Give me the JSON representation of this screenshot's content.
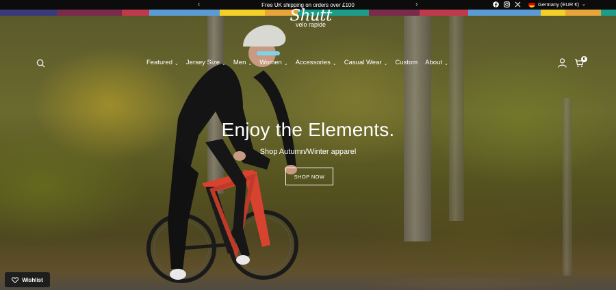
{
  "announcement": {
    "text": "Free UK shipping on orders over £100",
    "prev_icon": "chevron-left-icon",
    "next_icon": "chevron-right-icon"
  },
  "stripe_colors": [
    "#3a3a7a",
    "#7a2a4a",
    "#c0394b",
    "#5b9bd5",
    "#5b9bd5",
    "#f2d027",
    "#e8a63a",
    "#1a9e8a",
    "#7a2a4a",
    "#c0394b",
    "#5b9bd5",
    "#f2d027",
    "#e8a63a",
    "#1a9e8a"
  ],
  "social": {
    "items": [
      "facebook-icon",
      "instagram-icon",
      "x-icon"
    ]
  },
  "locale": {
    "label": "Germany (EUR €)",
    "flag_colors": [
      "#000000",
      "#dd0000",
      "#ffce00"
    ]
  },
  "logo": {
    "script": "Shutt",
    "sub": "velo rapide"
  },
  "nav": {
    "items": [
      {
        "label": "Featured",
        "has_dropdown": true
      },
      {
        "label": "Jersey Size",
        "has_dropdown": true
      },
      {
        "label": "Men",
        "has_dropdown": true
      },
      {
        "label": "Women",
        "has_dropdown": true
      },
      {
        "label": "Accessories",
        "has_dropdown": true
      },
      {
        "label": "Casual Wear",
        "has_dropdown": true
      },
      {
        "label": "Custom",
        "has_dropdown": false
      },
      {
        "label": "About",
        "has_dropdown": true
      }
    ]
  },
  "cart": {
    "count": "0"
  },
  "hero": {
    "headline": "Enjoy the Elements.",
    "subline": "Shop Autumn/Winter apparel",
    "button": "SHOP NOW"
  },
  "wishlist": {
    "label": "Wishlist"
  },
  "colors": {
    "bike_frame": "#d8432f",
    "helmet": "#d9d9d4",
    "jersey": "#141414"
  }
}
